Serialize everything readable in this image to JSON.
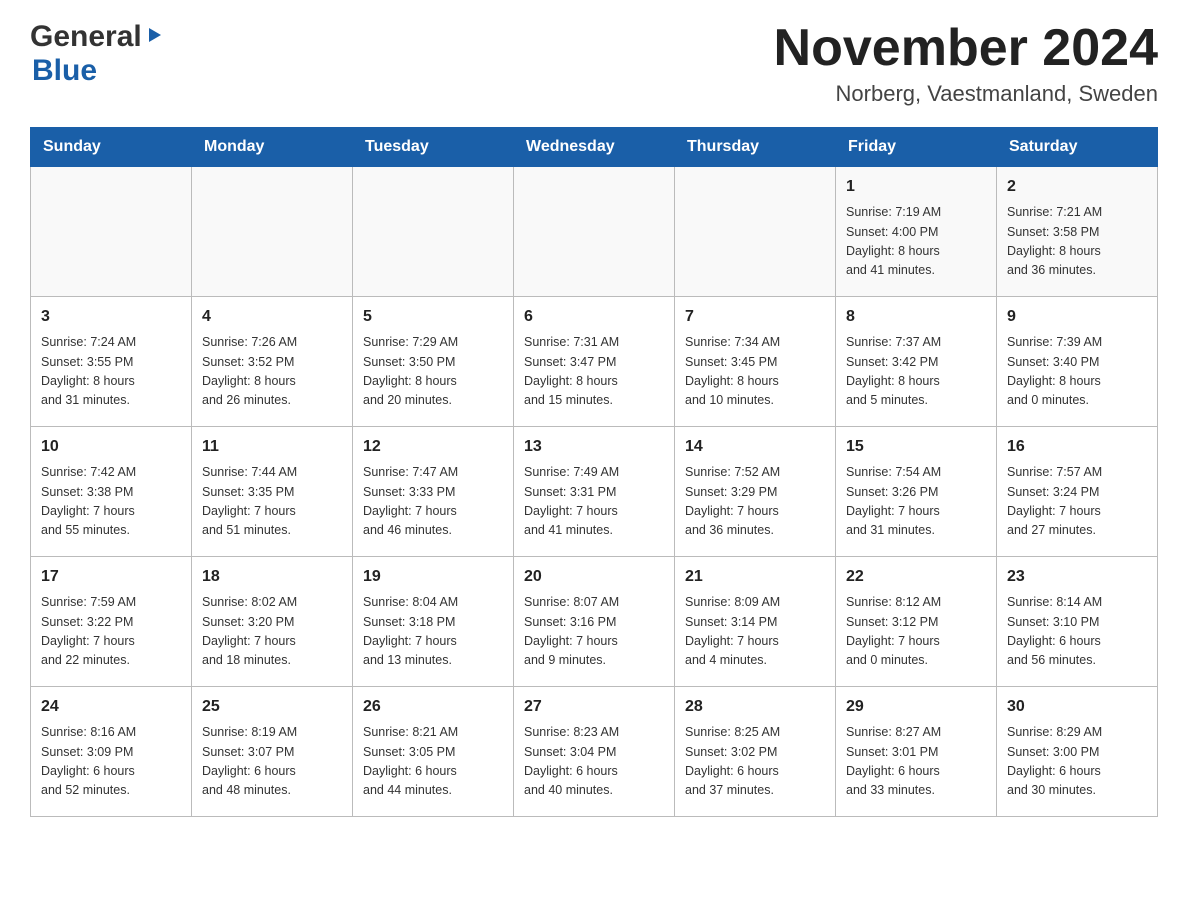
{
  "header": {
    "logo": {
      "general": "General",
      "blue": "Blue"
    },
    "title": "November 2024",
    "location": "Norberg, Vaestmanland, Sweden"
  },
  "calendar": {
    "days_of_week": [
      "Sunday",
      "Monday",
      "Tuesday",
      "Wednesday",
      "Thursday",
      "Friday",
      "Saturday"
    ],
    "weeks": [
      {
        "days": [
          {
            "num": "",
            "info": ""
          },
          {
            "num": "",
            "info": ""
          },
          {
            "num": "",
            "info": ""
          },
          {
            "num": "",
            "info": ""
          },
          {
            "num": "",
            "info": ""
          },
          {
            "num": "1",
            "info": "Sunrise: 7:19 AM\nSunset: 4:00 PM\nDaylight: 8 hours\nand 41 minutes."
          },
          {
            "num": "2",
            "info": "Sunrise: 7:21 AM\nSunset: 3:58 PM\nDaylight: 8 hours\nand 36 minutes."
          }
        ]
      },
      {
        "days": [
          {
            "num": "3",
            "info": "Sunrise: 7:24 AM\nSunset: 3:55 PM\nDaylight: 8 hours\nand 31 minutes."
          },
          {
            "num": "4",
            "info": "Sunrise: 7:26 AM\nSunset: 3:52 PM\nDaylight: 8 hours\nand 26 minutes."
          },
          {
            "num": "5",
            "info": "Sunrise: 7:29 AM\nSunset: 3:50 PM\nDaylight: 8 hours\nand 20 minutes."
          },
          {
            "num": "6",
            "info": "Sunrise: 7:31 AM\nSunset: 3:47 PM\nDaylight: 8 hours\nand 15 minutes."
          },
          {
            "num": "7",
            "info": "Sunrise: 7:34 AM\nSunset: 3:45 PM\nDaylight: 8 hours\nand 10 minutes."
          },
          {
            "num": "8",
            "info": "Sunrise: 7:37 AM\nSunset: 3:42 PM\nDaylight: 8 hours\nand 5 minutes."
          },
          {
            "num": "9",
            "info": "Sunrise: 7:39 AM\nSunset: 3:40 PM\nDaylight: 8 hours\nand 0 minutes."
          }
        ]
      },
      {
        "days": [
          {
            "num": "10",
            "info": "Sunrise: 7:42 AM\nSunset: 3:38 PM\nDaylight: 7 hours\nand 55 minutes."
          },
          {
            "num": "11",
            "info": "Sunrise: 7:44 AM\nSunset: 3:35 PM\nDaylight: 7 hours\nand 51 minutes."
          },
          {
            "num": "12",
            "info": "Sunrise: 7:47 AM\nSunset: 3:33 PM\nDaylight: 7 hours\nand 46 minutes."
          },
          {
            "num": "13",
            "info": "Sunrise: 7:49 AM\nSunset: 3:31 PM\nDaylight: 7 hours\nand 41 minutes."
          },
          {
            "num": "14",
            "info": "Sunrise: 7:52 AM\nSunset: 3:29 PM\nDaylight: 7 hours\nand 36 minutes."
          },
          {
            "num": "15",
            "info": "Sunrise: 7:54 AM\nSunset: 3:26 PM\nDaylight: 7 hours\nand 31 minutes."
          },
          {
            "num": "16",
            "info": "Sunrise: 7:57 AM\nSunset: 3:24 PM\nDaylight: 7 hours\nand 27 minutes."
          }
        ]
      },
      {
        "days": [
          {
            "num": "17",
            "info": "Sunrise: 7:59 AM\nSunset: 3:22 PM\nDaylight: 7 hours\nand 22 minutes."
          },
          {
            "num": "18",
            "info": "Sunrise: 8:02 AM\nSunset: 3:20 PM\nDaylight: 7 hours\nand 18 minutes."
          },
          {
            "num": "19",
            "info": "Sunrise: 8:04 AM\nSunset: 3:18 PM\nDaylight: 7 hours\nand 13 minutes."
          },
          {
            "num": "20",
            "info": "Sunrise: 8:07 AM\nSunset: 3:16 PM\nDaylight: 7 hours\nand 9 minutes."
          },
          {
            "num": "21",
            "info": "Sunrise: 8:09 AM\nSunset: 3:14 PM\nDaylight: 7 hours\nand 4 minutes."
          },
          {
            "num": "22",
            "info": "Sunrise: 8:12 AM\nSunset: 3:12 PM\nDaylight: 7 hours\nand 0 minutes."
          },
          {
            "num": "23",
            "info": "Sunrise: 8:14 AM\nSunset: 3:10 PM\nDaylight: 6 hours\nand 56 minutes."
          }
        ]
      },
      {
        "days": [
          {
            "num": "24",
            "info": "Sunrise: 8:16 AM\nSunset: 3:09 PM\nDaylight: 6 hours\nand 52 minutes."
          },
          {
            "num": "25",
            "info": "Sunrise: 8:19 AM\nSunset: 3:07 PM\nDaylight: 6 hours\nand 48 minutes."
          },
          {
            "num": "26",
            "info": "Sunrise: 8:21 AM\nSunset: 3:05 PM\nDaylight: 6 hours\nand 44 minutes."
          },
          {
            "num": "27",
            "info": "Sunrise: 8:23 AM\nSunset: 3:04 PM\nDaylight: 6 hours\nand 40 minutes."
          },
          {
            "num": "28",
            "info": "Sunrise: 8:25 AM\nSunset: 3:02 PM\nDaylight: 6 hours\nand 37 minutes."
          },
          {
            "num": "29",
            "info": "Sunrise: 8:27 AM\nSunset: 3:01 PM\nDaylight: 6 hours\nand 33 minutes."
          },
          {
            "num": "30",
            "info": "Sunrise: 8:29 AM\nSunset: 3:00 PM\nDaylight: 6 hours\nand 30 minutes."
          }
        ]
      }
    ]
  }
}
